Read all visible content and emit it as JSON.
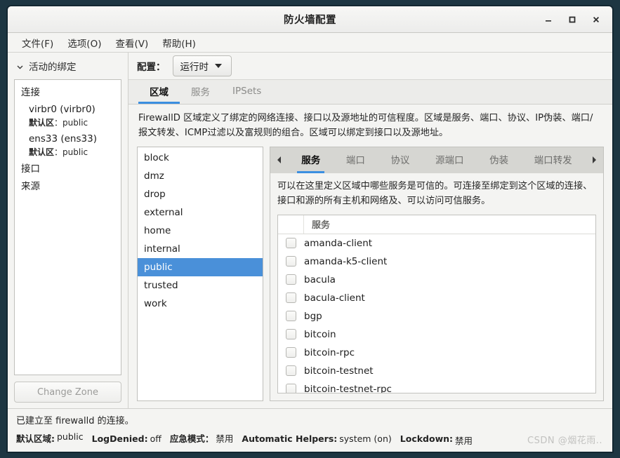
{
  "window": {
    "title": "防火墙配置",
    "controls": [
      {
        "name": "minimize",
        "glyph": "minimize-icon"
      },
      {
        "name": "maximize",
        "glyph": "maximize-icon"
      },
      {
        "name": "close",
        "glyph": "close-icon"
      }
    ]
  },
  "menubar": {
    "items": [
      {
        "label": "文件(F)"
      },
      {
        "label": "选项(O)"
      },
      {
        "label": "查看(V)"
      },
      {
        "label": "帮助(H)"
      }
    ]
  },
  "sidebar": {
    "header": "活动的绑定",
    "groups": [
      {
        "title": "连接",
        "entries": [
          {
            "name": "virbr0 (virbr0)",
            "sub_label": "默认区",
            "sub_value": "public"
          },
          {
            "name": "ens33 (ens33)",
            "sub_label": "默认区",
            "sub_value": "public"
          }
        ]
      },
      {
        "title": "接口",
        "entries": []
      },
      {
        "title": "来源",
        "entries": []
      }
    ],
    "change_zone_label": "Change Zone",
    "change_zone_enabled": false
  },
  "config": {
    "label": "配置：",
    "selected": "运行时"
  },
  "outer_tabs": [
    {
      "label": "区域",
      "active": true
    },
    {
      "label": "服务",
      "active": false
    },
    {
      "label": "IPSets",
      "active": false
    }
  ],
  "zone_description": "FirewallD 区域定义了绑定的网络连接、接口以及源地址的可信程度。区域是服务、端口、协议、IP伪装、端口/报文转发、ICMP过滤以及富规则的组合。区域可以绑定到接口以及源地址。",
  "zones": [
    {
      "name": "block",
      "selected": false
    },
    {
      "name": "dmz",
      "selected": false
    },
    {
      "name": "drop",
      "selected": false
    },
    {
      "name": "external",
      "selected": false
    },
    {
      "name": "home",
      "selected": false
    },
    {
      "name": "internal",
      "selected": false
    },
    {
      "name": "public",
      "selected": true
    },
    {
      "name": "trusted",
      "selected": false
    },
    {
      "name": "work",
      "selected": false
    }
  ],
  "inner_tabs": {
    "scroll_left": "◀",
    "scroll_right": "▶",
    "items": [
      {
        "label": "服务",
        "active": true
      },
      {
        "label": "端口",
        "active": false
      },
      {
        "label": "协议",
        "active": false
      },
      {
        "label": "源端口",
        "active": false
      },
      {
        "label": "伪装",
        "active": false
      },
      {
        "label": "端口转发",
        "active": false
      }
    ]
  },
  "services_panel": {
    "description": "可以在这里定义区域中哪些服务是可信的。可连接至绑定到这个区域的连接、接口和源的所有主机和网络及、可以访问可信服务。",
    "column_header": "服务",
    "rows": [
      {
        "name": "amanda-client",
        "checked": false
      },
      {
        "name": "amanda-k5-client",
        "checked": false
      },
      {
        "name": "bacula",
        "checked": false
      },
      {
        "name": "bacula-client",
        "checked": false
      },
      {
        "name": "bgp",
        "checked": false
      },
      {
        "name": "bitcoin",
        "checked": false
      },
      {
        "name": "bitcoin-rpc",
        "checked": false
      },
      {
        "name": "bitcoin-testnet",
        "checked": false
      },
      {
        "name": "bitcoin-testnet-rpc",
        "checked": false
      }
    ]
  },
  "statusbar": {
    "connection_text": "已建立至 firewalld 的连接。",
    "items": [
      {
        "label": "默认区域:",
        "value": "public"
      },
      {
        "label": "LogDenied:",
        "value": "off"
      },
      {
        "label": "应急模式：",
        "value": "禁用"
      },
      {
        "label": "Automatic Helpers:",
        "value": "system (on)"
      },
      {
        "label": "Lockdown:",
        "value": "禁用"
      }
    ],
    "watermark": "CSDN @烟花雨.."
  },
  "colors": {
    "accent": "#3b8fe0",
    "selection": "#4a90d9",
    "window_border": "#1d3642"
  }
}
